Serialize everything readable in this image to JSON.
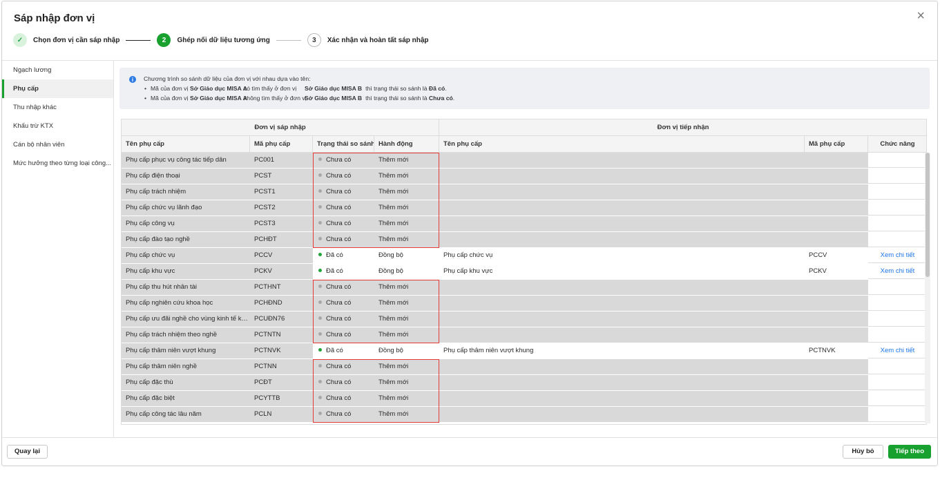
{
  "dialog": {
    "title": "Sáp nhập đơn vị",
    "close_icon": "×"
  },
  "steps": [
    {
      "marker": "✓",
      "label": "Chọn đơn vị cần sáp nhập",
      "state": "done"
    },
    {
      "marker": "2",
      "label": "Ghép nối dữ liệu tương ứng",
      "state": "active"
    },
    {
      "marker": "3",
      "label": "Xác nhận và hoàn tất sáp nhập",
      "state": "todo"
    }
  ],
  "sidebar": {
    "items": [
      {
        "label": "Ngạch lương"
      },
      {
        "label": "Phụ cấp",
        "active": true
      },
      {
        "label": "Thu nhập khác"
      },
      {
        "label": "Khấu trừ KTX"
      },
      {
        "label": "Cán bộ nhân viên"
      },
      {
        "label": "Mức hưởng theo từng loại công..."
      }
    ]
  },
  "info": {
    "icon": "i",
    "main": "Chương trình so sánh dữ liệu của đơn vị với nhau dựa vào tên:",
    "line1": {
      "bullet": "•",
      "p1": "Mã của đơn vị",
      "unit_a": "Sở Giáo dục MISA A",
      "p2": "có tìm thấy ở đơn vị",
      "unit_b": "Sở Giáo dục MISA B",
      "p3": "thì trạng thái so sánh là",
      "status": "Đã có",
      "end": "."
    },
    "line2": {
      "bullet": "•",
      "p1": "Mã của đơn vị",
      "unit_a": "Sở Giáo dục MISA A",
      "p2": "không tìm thấy ở đơn vị",
      "unit_b": "Sở Giáo dục MISA B",
      "p3": "thì trạng thái so sánh là",
      "status": "Chưa có",
      "end": "."
    }
  },
  "table": {
    "group_source": "Đơn vị sáp nhập",
    "group_target": "Đơn vị tiếp nhận",
    "columns": {
      "name": "Tên phụ cấp",
      "code": "Mã phụ cấp",
      "status": "Trạng thái so sánh",
      "action": "Hành động",
      "target_name": "Tên phụ cấp",
      "target_code": "Mã phụ cấp",
      "function": "Chức năng"
    },
    "rows": [
      {
        "name": "Phụ cấp phục vụ công tác tiếp dân",
        "code": "PC001",
        "status": "Chưa có",
        "matched": false,
        "action": "Thêm mới"
      },
      {
        "name": "Phụ cấp điện thoại",
        "code": "PCST",
        "status": "Chưa có",
        "matched": false,
        "action": "Thêm mới"
      },
      {
        "name": "Phụ cấp trách nhiệm",
        "code": "PCST1",
        "status": "Chưa có",
        "matched": false,
        "action": "Thêm mới"
      },
      {
        "name": "Phụ cấp chức vụ lãnh đạo",
        "code": "PCST2",
        "status": "Chưa có",
        "matched": false,
        "action": "Thêm mới"
      },
      {
        "name": "Phụ cấp công vụ",
        "code": "PCST3",
        "status": "Chưa có",
        "matched": false,
        "action": "Thêm mới"
      },
      {
        "name": "Phụ cấp đào tạo nghề",
        "code": "PCHĐT",
        "status": "Chưa có",
        "matched": false,
        "action": "Thêm mới"
      },
      {
        "name": "Phụ cấp chức vụ",
        "code": "PCCV",
        "status": "Đã có",
        "matched": true,
        "action": "Đồng bộ",
        "target_name": "Phụ cấp chức vụ",
        "target_code": "PCCV",
        "link": "Xem chi tiết"
      },
      {
        "name": "Phụ cấp khu vực",
        "code": "PCKV",
        "status": "Đã có",
        "matched": true,
        "action": "Đồng bộ",
        "target_name": "Phụ cấp khu vực",
        "target_code": "PCKV",
        "link": "Xem chi tiết"
      },
      {
        "name": "Phụ cấp thu hút nhân tài",
        "code": "PCTHNT",
        "status": "Chưa có",
        "matched": false,
        "action": "Thêm mới"
      },
      {
        "name": "Phụ cấp nghiên cứu khoa học",
        "code": "PCHĐND",
        "status": "Chưa có",
        "matched": false,
        "action": "Thêm mới"
      },
      {
        "name": "Phụ cấp ưu đãi nghề cho vùng kinh tế khó ...",
        "code": "PCUĐN76",
        "status": "Chưa có",
        "matched": false,
        "action": "Thêm mới"
      },
      {
        "name": "Phụ cấp trách nhiệm theo nghề",
        "code": "PCTNTN",
        "status": "Chưa có",
        "matched": false,
        "action": "Thêm mới"
      },
      {
        "name": "Phụ cấp thâm niên vượt khung",
        "code": "PCTNVK",
        "status": "Đã có",
        "matched": true,
        "action": "Đồng bộ",
        "target_name": "Phụ cấp thâm niên vượt khung",
        "target_code": "PCTNVK",
        "link": "Xem chi tiết"
      },
      {
        "name": "Phụ cấp thâm niên nghề",
        "code": "PCTNN",
        "status": "Chưa có",
        "matched": false,
        "action": "Thêm mới"
      },
      {
        "name": "Phụ cấp đặc thù",
        "code": "PCĐT",
        "status": "Chưa có",
        "matched": false,
        "action": "Thêm mới"
      },
      {
        "name": "Phụ cấp đặc biệt",
        "code": "PCYTTB",
        "status": "Chưa có",
        "matched": false,
        "action": "Thêm mới"
      },
      {
        "name": "Phụ cấp công tác lâu năm",
        "code": "PCLN",
        "status": "Chưa có",
        "matched": false,
        "action": "Thêm mới"
      }
    ]
  },
  "footer": {
    "back": "Quay lại",
    "cancel": "Hủy bỏ",
    "next": "Tiếp theo"
  },
  "colors": {
    "accent": "#19a12f",
    "link": "#1a73e8",
    "highlight": "#e53935",
    "info_icon": "#2d7be5"
  }
}
